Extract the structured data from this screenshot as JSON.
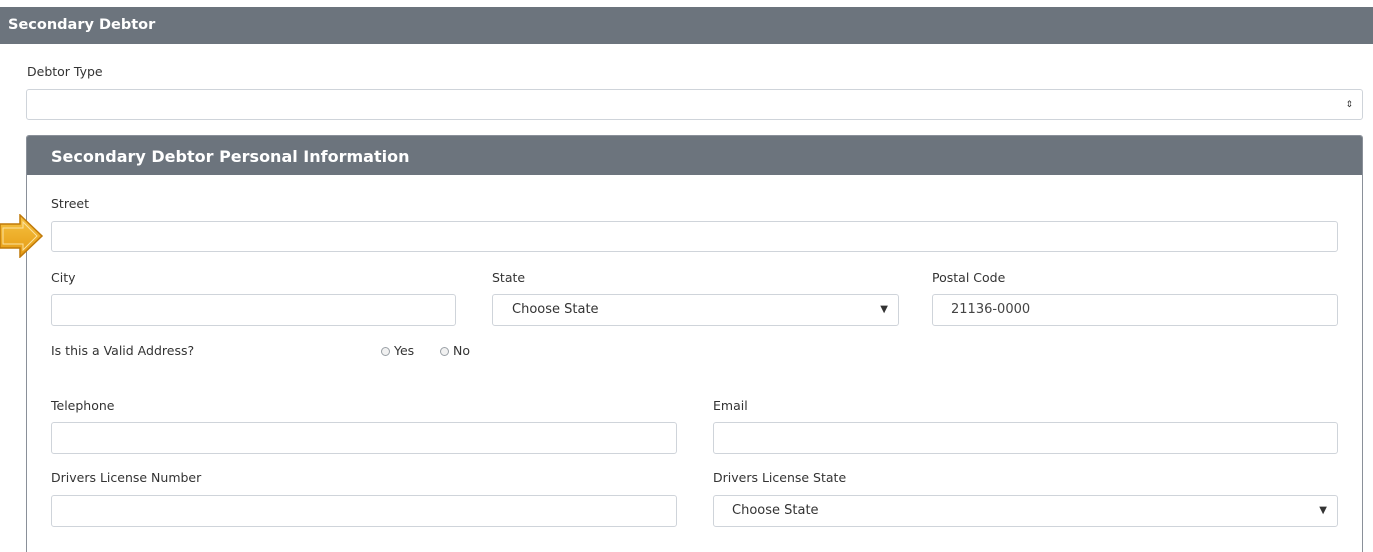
{
  "section": {
    "title": "Secondary Debtor"
  },
  "debtor_type": {
    "label": "Debtor Type",
    "value": ""
  },
  "panel": {
    "title": "Secondary Debtor Personal Information",
    "street": {
      "label": "Street",
      "value": ""
    },
    "city": {
      "label": "City",
      "value": ""
    },
    "state": {
      "label": "State",
      "selected": "Choose State"
    },
    "postal_code": {
      "label": "Postal Code",
      "value": "21136-0000"
    },
    "valid_address": {
      "label": "Is this a Valid Address?",
      "yes": "Yes",
      "no": "No"
    },
    "telephone": {
      "label": "Telephone",
      "value": ""
    },
    "email": {
      "label": "Email",
      "value": ""
    },
    "dl_number": {
      "label": "Drivers License Number",
      "value": ""
    },
    "dl_state": {
      "label": "Drivers License State",
      "selected": "Choose State"
    }
  },
  "colors": {
    "header_bg": "#6c747d",
    "border": "#cfd4da",
    "arrow": "#e8a317"
  },
  "icons": {
    "pointer": "arrow-right-icon",
    "select_toggle": "sort-icon",
    "dropdown": "caret-down-icon"
  }
}
